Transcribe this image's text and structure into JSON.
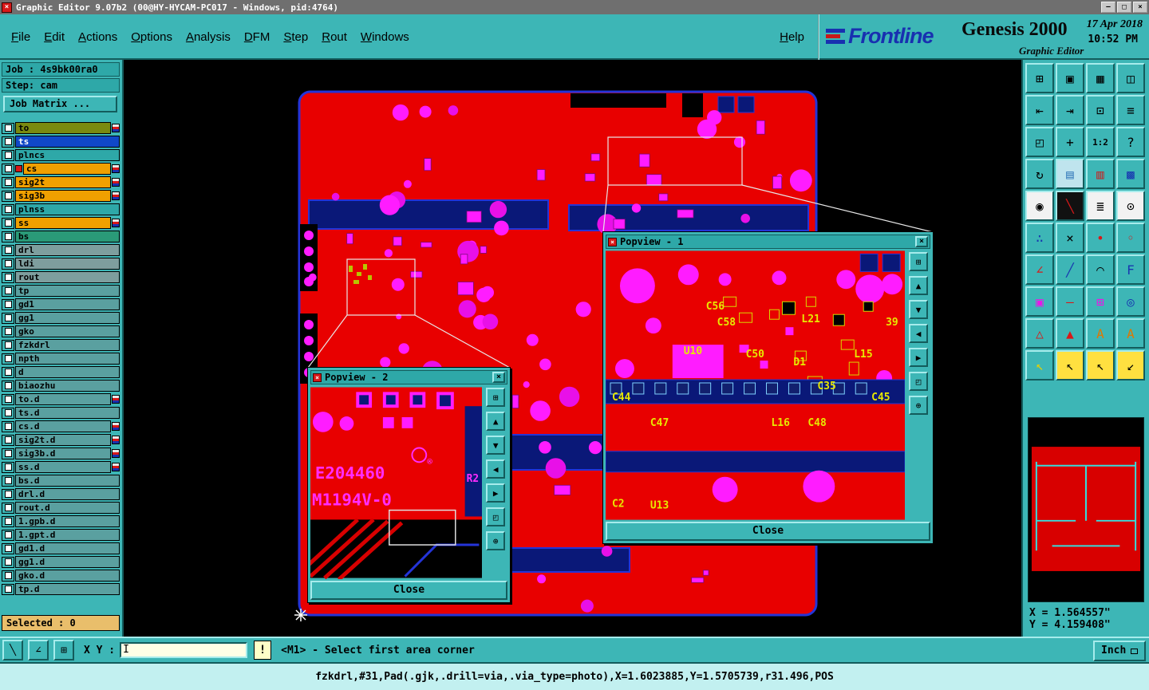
{
  "title_bar": {
    "title": "Graphic Editor 9.07b2 (00@HY-HYCAM-PC017 - Windows, pid:4764)",
    "app_icon_glyph": "×",
    "controls": [
      {
        "name": "minimize",
        "glyph": "—"
      },
      {
        "name": "maximize",
        "glyph": "□"
      },
      {
        "name": "close",
        "glyph": "×"
      }
    ]
  },
  "menu_bar": {
    "menus": [
      "File",
      "Edit",
      "Actions",
      "Options",
      "Analysis",
      "DFM",
      "Step",
      "Rout",
      "Windows"
    ],
    "help": "Help"
  },
  "brand": {
    "logo_text": "Frontline",
    "product": "Genesis 2000",
    "subtitle": "Graphic Editor",
    "date": "17 Apr 2018",
    "time": "10:52 PM"
  },
  "sidebar": {
    "job_label": "Job : 4s9bk00ra0",
    "step_label": "Step: cam",
    "job_matrix_button": "Job Matrix ...",
    "selected_label": "Selected : 0",
    "layers": [
      {
        "name": "to",
        "color": "#7a8a10",
        "chip": true
      },
      {
        "name": "ts",
        "color": "#1048c8",
        "text_color": "#ffffff"
      },
      {
        "name": "plncs",
        "color": "#2ea8a8"
      },
      {
        "name": "cs",
        "color": "#f0a000",
        "chip": true,
        "active": true
      },
      {
        "name": "sig2t",
        "color": "#f0a000",
        "chip": true
      },
      {
        "name": "sig3b",
        "color": "#f0a000",
        "chip": true
      },
      {
        "name": "plnss",
        "color": "#2ea8a8"
      },
      {
        "name": "ss",
        "color": "#f0a000",
        "chip": true
      },
      {
        "name": "bs",
        "color": "#2a9a78"
      },
      {
        "name": "drl",
        "color": "#7e9e9e"
      },
      {
        "name": "ldi",
        "color": "#7e9e9e"
      },
      {
        "name": "rout",
        "color": "#7e9e9e"
      },
      {
        "name": "tp",
        "color": "#5aa0a0"
      },
      {
        "name": "gd1",
        "color": "#5aa0a0"
      },
      {
        "name": "gg1",
        "color": "#5aa0a0"
      },
      {
        "name": "gko",
        "color": "#5aa0a0"
      },
      {
        "name": "fzkdrl",
        "color": "#5aa0a0"
      },
      {
        "name": "npth",
        "color": "#5aa0a0"
      },
      {
        "name": "d",
        "color": "#5aa0a0"
      },
      {
        "name": "biaozhu",
        "color": "#5aa0a0"
      },
      {
        "name": "to.d",
        "color": "#5aa0a0",
        "chip": true
      },
      {
        "name": "ts.d",
        "color": "#5aa0a0"
      },
      {
        "name": "cs.d",
        "color": "#5aa0a0",
        "chip": true
      },
      {
        "name": "sig2t.d",
        "color": "#5aa0a0",
        "chip": true
      },
      {
        "name": "sig3b.d",
        "color": "#5aa0a0",
        "chip": true
      },
      {
        "name": "ss.d",
        "color": "#5aa0a0",
        "chip": true
      },
      {
        "name": "bs.d",
        "color": "#5aa0a0"
      },
      {
        "name": "drl.d",
        "color": "#5aa0a0"
      },
      {
        "name": "rout.d",
        "color": "#5aa0a0"
      },
      {
        "name": "1.gpb.d",
        "color": "#5aa0a0"
      },
      {
        "name": "1.gpt.d",
        "color": "#5aa0a0"
      },
      {
        "name": "gd1.d",
        "color": "#5aa0a0"
      },
      {
        "name": "gg1.d",
        "color": "#5aa0a0"
      },
      {
        "name": "gko.d",
        "color": "#5aa0a0"
      },
      {
        "name": "tp.d",
        "color": "#5aa0a0"
      }
    ]
  },
  "popviews": [
    {
      "title": "Popview - 1",
      "close_label": "Close",
      "labels": [
        "C56",
        "C58",
        "L21",
        "39",
        "U10",
        "C50",
        "D1",
        "L15",
        "C35",
        "C44",
        "C47",
        "L16",
        "C48",
        "C45",
        "C2",
        "U13"
      ],
      "side_buttons": [
        {
          "name": "popout-button",
          "glyph": "⊞"
        },
        {
          "name": "pan-up-button",
          "glyph": "▲"
        },
        {
          "name": "pan-down-button",
          "glyph": "▼"
        },
        {
          "name": "pan-left-button",
          "glyph": "◀"
        },
        {
          "name": "pan-right-button",
          "glyph": "▶"
        },
        {
          "name": "zoom-fit-button",
          "glyph": "◰"
        },
        {
          "name": "center-button",
          "glyph": "⊕"
        }
      ]
    },
    {
      "title": "Popview - 2",
      "close_label": "Close",
      "labels": [
        "E204460",
        "®",
        "M1194V-0",
        "R2"
      ],
      "side_buttons": [
        {
          "name": "popout-button",
          "glyph": "⊞"
        },
        {
          "name": "pan-up-button",
          "glyph": "▲"
        },
        {
          "name": "pan-down-button",
          "glyph": "▼"
        },
        {
          "name": "pan-left-button",
          "glyph": "◀"
        },
        {
          "name": "pan-right-button",
          "glyph": "▶"
        },
        {
          "name": "zoom-fit-button",
          "glyph": "◰"
        },
        {
          "name": "center-button",
          "glyph": "⊕"
        }
      ]
    }
  ],
  "right_toolbar": {
    "buttons": [
      {
        "name": "window-raise",
        "glyph": "⊞"
      },
      {
        "name": "screen-view",
        "glyph": "▣"
      },
      {
        "name": "tile-view",
        "glyph": "▦"
      },
      {
        "name": "split-view",
        "glyph": "◫"
      },
      {
        "name": "shift-left",
        "glyph": "⇤"
      },
      {
        "name": "shift-right",
        "glyph": "⇥"
      },
      {
        "name": "cascade-windows",
        "glyph": "⊡"
      },
      {
        "name": "layer-stack",
        "glyph": "≡"
      },
      {
        "name": "zoom-window",
        "glyph": "◰"
      },
      {
        "name": "pan-view",
        "glyph": "+"
      },
      {
        "name": "scale-1-2",
        "glyph": "1:2",
        "small": true
      },
      {
        "name": "help",
        "glyph": "?"
      },
      {
        "name": "redraw",
        "glyph": "↻"
      },
      {
        "name": "grid-snap",
        "glyph": "▤",
        "bg": "#bfe4ee",
        "fg": "#3a7ebc"
      },
      {
        "name": "layer-compare",
        "glyph": "▥",
        "fg": "#c02828"
      },
      {
        "name": "raster-grid",
        "glyph": "▩",
        "fg": "#1838b0"
      },
      {
        "name": "circle-select",
        "glyph": "◉",
        "bg": "#f2f2f2"
      },
      {
        "name": "clip-area",
        "glyph": "╲",
        "bg": "#111111",
        "fg": "#d81818"
      },
      {
        "name": "measure-comb",
        "glyph": "≣",
        "bg": "#f2f2f2"
      },
      {
        "name": "origin-dot",
        "glyph": "⊙",
        "bg": "#f2f2f2"
      },
      {
        "name": "snap-points",
        "glyph": "∴",
        "fg": "#1838b0"
      },
      {
        "name": "delete-object",
        "glyph": "×"
      },
      {
        "name": "point-mark",
        "glyph": "•",
        "fg": "#d81818"
      },
      {
        "name": "point-ref",
        "glyph": "◦",
        "fg": "#d81818"
      },
      {
        "name": "angle-measure",
        "glyph": "∠",
        "fg": "#d81818"
      },
      {
        "name": "line-draw",
        "glyph": "╱",
        "fg": "#1838b0"
      },
      {
        "name": "arc-draw",
        "glyph": "◠"
      },
      {
        "name": "flip-tool",
        "glyph": "F",
        "fg": "#1838b0"
      },
      {
        "name": "pad-frame",
        "glyph": "▣",
        "fg": "#e818e8"
      },
      {
        "name": "dash-line",
        "glyph": "—",
        "fg": "#d81818"
      },
      {
        "name": "move-grid",
        "glyph": "⊞",
        "fg": "#e818e8"
      },
      {
        "name": "circle-overlay",
        "glyph": "◎",
        "fg": "#1838b0"
      },
      {
        "name": "triangle-outline",
        "glyph": "△",
        "fg": "#d81818"
      },
      {
        "name": "triangle-solid",
        "glyph": "▲",
        "fg": "#d81818"
      },
      {
        "name": "text-arrow",
        "glyph": "A",
        "fg": "#e07800"
      },
      {
        "name": "text-delete",
        "glyph": "A",
        "fg": "#e07800"
      },
      {
        "name": "cursor-primary",
        "glyph": "↖",
        "fg": "#e8d000"
      },
      {
        "name": "cursor-secondary",
        "glyph": "↖",
        "bg": "#ffe040"
      },
      {
        "name": "cursor-text",
        "glyph": "↖",
        "bg": "#ffe040"
      },
      {
        "name": "cursor-bend",
        "glyph": "↙",
        "bg": "#ffe040"
      }
    ]
  },
  "coords": {
    "x": "X = 1.564557\"",
    "y": "Y = 4.159408\""
  },
  "bottom_bar": {
    "mode_buttons": [
      {
        "name": "select-mode",
        "glyph": "╲"
      },
      {
        "name": "angle-mode",
        "glyph": "∠"
      },
      {
        "name": "grid-mode",
        "glyph": "⊞"
      }
    ],
    "xy_label": "X Y :",
    "input_value": "",
    "alert_button": "!",
    "status_message": "<M1> - Select first area corner",
    "units_button": "Inch"
  },
  "info_bar": {
    "text": "fzkdrl,#31,Pad(.gjk,.drill=via,.via_type=photo),X=1.6023885,Y=1.5705739,r31.496,POS"
  },
  "icons": {
    "close": "×",
    "caret": "I"
  }
}
